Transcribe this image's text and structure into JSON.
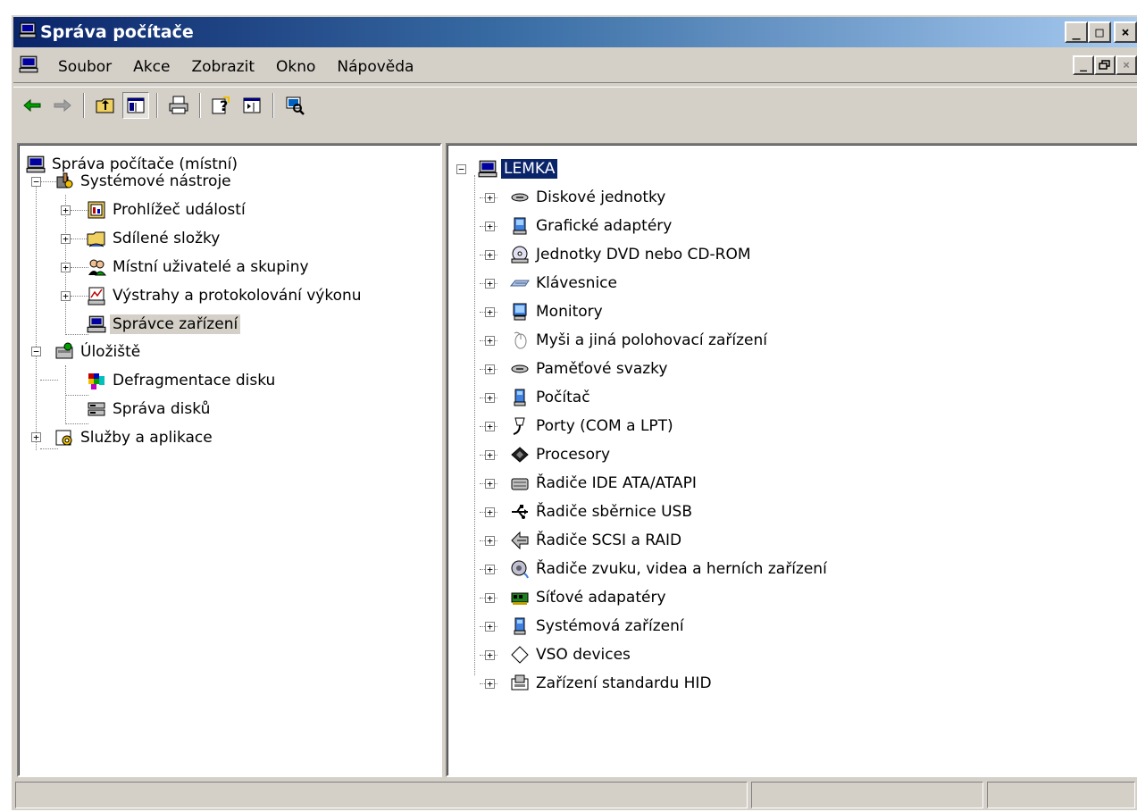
{
  "window": {
    "title": "Správa počítače"
  },
  "menubar": {
    "items": [
      "Soubor",
      "Akce",
      "Zobrazit",
      "Okno",
      "Nápověda"
    ]
  },
  "caption_buttons": {
    "minimize": "_",
    "maximize": "□",
    "close": "×"
  },
  "mdi_buttons": {
    "minimize": "_",
    "restore": "🗗",
    "close": "×"
  },
  "left_tree": {
    "root": "Správa počítače (místní)",
    "system_tools": "Systémové nástroje",
    "event_viewer": "Prohlížeč událostí",
    "shared_folders": "Sdílené složky",
    "local_users": "Místní uživatelé a skupiny",
    "perf_logs": "Výstrahy a protokolování výkonu",
    "device_manager": "Správce zařízení",
    "storage": "Úložiště",
    "defrag": "Defragmentace disku",
    "disk_mgmt": "Správa disků",
    "services": "Služby a aplikace"
  },
  "right_tree": {
    "root": "LEMKA",
    "items": [
      {
        "label": "Diskové jednotky",
        "icon": "disk-drive-icon"
      },
      {
        "label": "Grafické adaptéry",
        "icon": "display-adapter-icon"
      },
      {
        "label": "Jednotky DVD nebo CD-ROM",
        "icon": "cdrom-icon"
      },
      {
        "label": "Klávesnice",
        "icon": "keyboard-icon"
      },
      {
        "label": "Monitory",
        "icon": "monitor-icon"
      },
      {
        "label": "Myši a jiná polohovací zařízení",
        "icon": "mouse-icon"
      },
      {
        "label": "Paměťové svazky",
        "icon": "storage-volume-icon"
      },
      {
        "label": "Počítač",
        "icon": "computer-icon"
      },
      {
        "label": "Porty (COM a LPT)",
        "icon": "port-icon"
      },
      {
        "label": "Procesory",
        "icon": "processor-icon"
      },
      {
        "label": "Řadiče IDE ATA/ATAPI",
        "icon": "ide-controller-icon"
      },
      {
        "label": "Řadiče sběrnice USB",
        "icon": "usb-icon"
      },
      {
        "label": "Řadiče SCSI a RAID",
        "icon": "scsi-icon"
      },
      {
        "label": "Řadiče zvuku, videa a herních zařízení",
        "icon": "sound-icon"
      },
      {
        "label": "Síťové adapatéry",
        "icon": "network-adapter-icon"
      },
      {
        "label": "Systémová zařízení",
        "icon": "system-device-icon"
      },
      {
        "label": "VSO devices",
        "icon": "vso-device-icon"
      },
      {
        "label": "Zařízení standardu HID",
        "icon": "hid-icon"
      }
    ]
  }
}
